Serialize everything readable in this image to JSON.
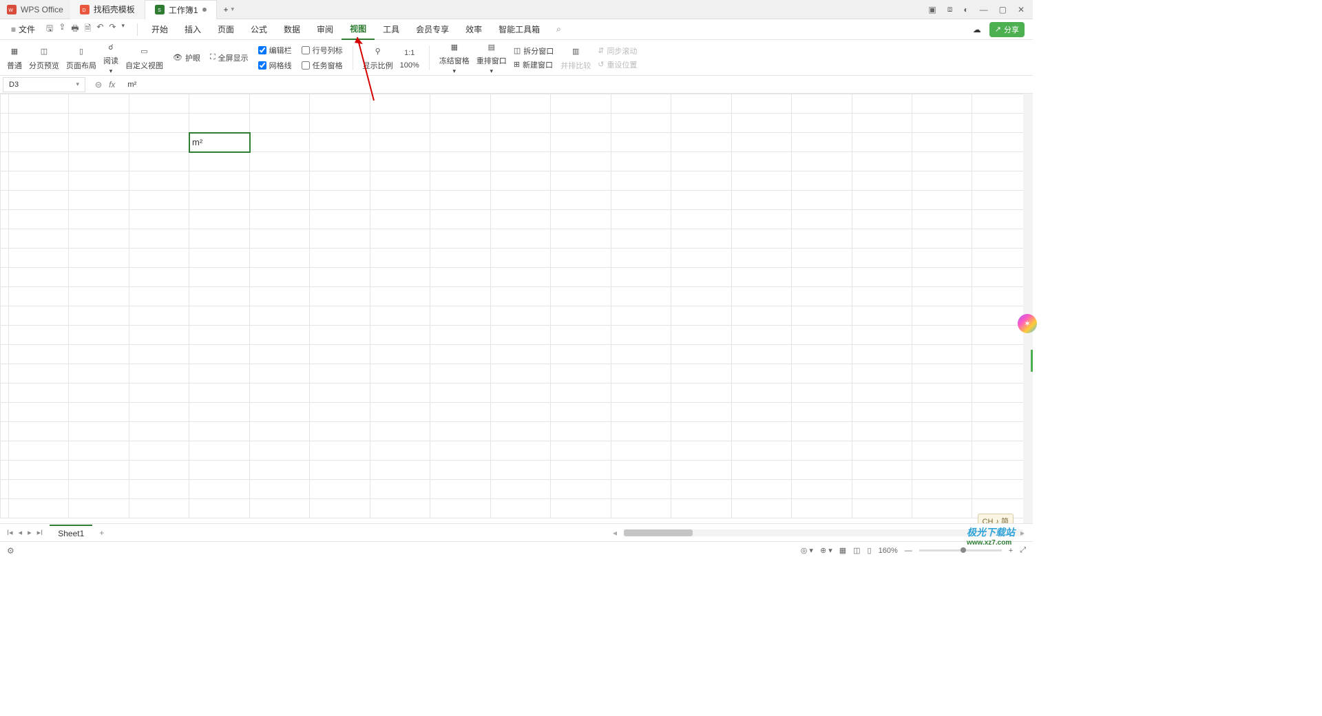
{
  "titlebar": {
    "app_name": "WPS Office",
    "tab1": "找稻壳模板",
    "tab2": "工作簿1",
    "add_icon": "+"
  },
  "menubar": {
    "file_label": "文件",
    "menus": [
      "开始",
      "插入",
      "页面",
      "公式",
      "数据",
      "审阅",
      "视图",
      "工具",
      "会员专享",
      "效率",
      "智能工具箱"
    ],
    "active_index": 6,
    "share_label": "分享"
  },
  "ribbon": {
    "view_modes": {
      "normal": "普通",
      "page_preview": "分页预览",
      "page_layout": "页面布局",
      "read": "阅读",
      "custom_view": "自定义视图"
    },
    "eye_protect": "护眼",
    "fullscreen": "全屏显示",
    "chk_editbar": "编辑栏",
    "chk_headings": "行号列标",
    "chk_gridlines": "网格线",
    "chk_taskpane": "任务窗格",
    "zoom_ratio": "显示比例",
    "zoom_100": "100%",
    "freeze_panes": "冻结窗格",
    "arrange": "重排窗口",
    "split": "拆分窗口",
    "new_window": "新建窗口",
    "side_by_side": "并排比较",
    "sync_scroll": "同步滚动",
    "reset_position": "重设位置"
  },
  "formula_bar": {
    "cell_ref": "D3",
    "fx": "fx",
    "value": "m²"
  },
  "grid": {
    "selected_cell_value": "m²"
  },
  "sheet_bar": {
    "sheet1": "Sheet1",
    "add": "+"
  },
  "status": {
    "ime": "CH ♪ 简",
    "zoom": "160%"
  },
  "watermark": {
    "main": "极光下载站",
    "sub": "www.xz7.com"
  }
}
